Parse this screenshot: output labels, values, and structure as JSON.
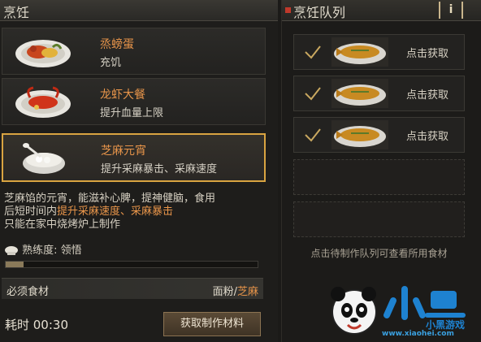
{
  "left_panel": {
    "title": "烹饪"
  },
  "recipes": [
    {
      "name": "烝螃蛋",
      "desc": "充饥"
    },
    {
      "name": "龙虾大餐",
      "desc": "提升血量上限"
    },
    {
      "name": "芝麻元宵",
      "desc": "提升采麻暴击、采麻速度"
    }
  ],
  "detail": {
    "line1": "芝麻馅的元宵，能滋补心脾，提神健脑，食用",
    "line2_prefix": "后短时间内",
    "line2_highlight": "提升采麻速度、采麻暴击",
    "line3": "只能在家中烧烤炉上制作"
  },
  "mastery": {
    "label": "熟练度: 领悟",
    "progress": 0.07
  },
  "ingredients": {
    "label": "必须食材",
    "item1": "面粉",
    "sep": "/",
    "item2": "芝麻"
  },
  "time": {
    "label": "耗时 00:30"
  },
  "buttons": {
    "get_materials": "获取制作材料"
  },
  "right_panel": {
    "title": "烹饪队列",
    "info_label": "i"
  },
  "queue": [
    {
      "status": "done",
      "action": "点击获取"
    },
    {
      "status": "done",
      "action": "点击获取"
    },
    {
      "status": "done",
      "action": "点击获取"
    }
  ],
  "queue_hint": "点击待制作队列可查看所用食材",
  "watermark": {
    "brand": "小黑游戏",
    "url": "www.xiaohei.com"
  },
  "colors": {
    "accent": "#e8954a",
    "selected_border": "#d9a441",
    "red_dot": "#c0392b"
  }
}
